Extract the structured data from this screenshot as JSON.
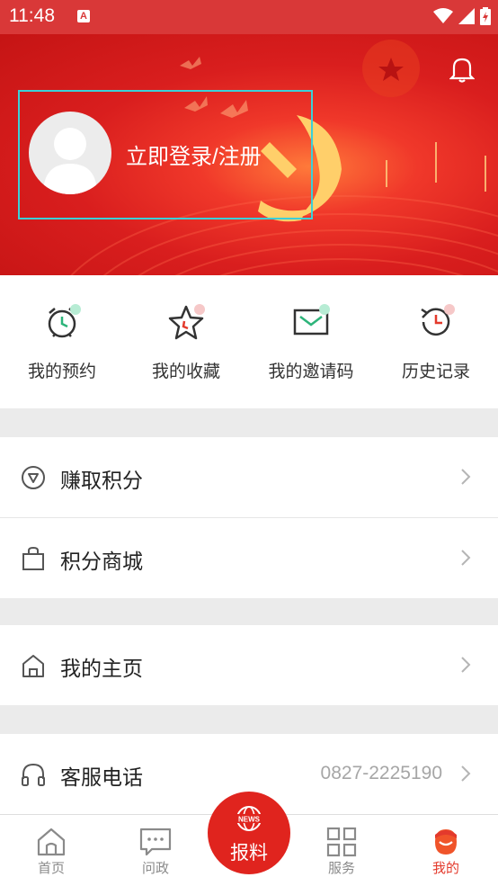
{
  "status_bar": {
    "time": "11:48",
    "app_badge": "A"
  },
  "header": {
    "login_label": "立即登录/注册"
  },
  "quick_actions": [
    {
      "label": "我的预约",
      "icon": "alarm-clock-icon"
    },
    {
      "label": "我的收藏",
      "icon": "star-icon"
    },
    {
      "label": "我的邀请码",
      "icon": "envelope-icon"
    },
    {
      "label": "历史记录",
      "icon": "history-clock-icon"
    }
  ],
  "menu": {
    "earn_points": "赚取积分",
    "points_mall": "积分商城",
    "my_homepage": "我的主页",
    "customer_service": "客服电话",
    "customer_service_phone": "0827-2225190"
  },
  "tabbar": {
    "home": "首页",
    "wenzheng": "问政",
    "report": "报料",
    "report_badge": "NEWS",
    "services": "服务",
    "mine": "我的"
  },
  "colors": {
    "brand_red": "#e0241e",
    "banner_red": "#d91e1e",
    "highlight_box": "#3bd0d8",
    "active_tab": "#e33a2c"
  }
}
